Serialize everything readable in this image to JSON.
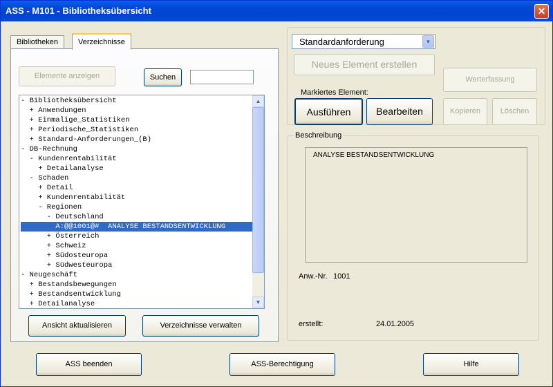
{
  "window": {
    "title": "ASS - M101 - Bibliotheksübersicht",
    "close_glyph": "✕"
  },
  "tabs": [
    {
      "label": "Bibliotheken",
      "active": false
    },
    {
      "label": "Verzeichnisse",
      "active": true
    }
  ],
  "left_panel": {
    "elemente_anzeigen": "Elemente anzeigen",
    "suchen": "Suchen",
    "search_value": "",
    "ansicht_aktualisieren": "Ansicht aktualisieren",
    "verzeichnisse_verwalten": "Verzeichnisse verwalten"
  },
  "tree": {
    "items": [
      {
        "text": "- Bibliotheksübersicht",
        "selected": false
      },
      {
        "text": "  + Anwendungen",
        "selected": false
      },
      {
        "text": "  + Einmalige_Statistiken",
        "selected": false
      },
      {
        "text": "  + Periodische_Statistiken",
        "selected": false
      },
      {
        "text": "  + Standard-Anforderungen_(B)",
        "selected": false
      },
      {
        "text": "- DB-Rechnung",
        "selected": false
      },
      {
        "text": "  - Kundenrentabilität",
        "selected": false
      },
      {
        "text": "    + Detailanalyse",
        "selected": false
      },
      {
        "text": "  - Schaden",
        "selected": false
      },
      {
        "text": "    + Detail",
        "selected": false
      },
      {
        "text": "    + Kundenrentabilität",
        "selected": false
      },
      {
        "text": "    - Regionen",
        "selected": false
      },
      {
        "text": "      - Deutschland",
        "selected": false
      },
      {
        "text": "        A:@@1001@#  ANALYSE BESTANDSENTWICKLUNG",
        "selected": true
      },
      {
        "text": "      + Österreich",
        "selected": false
      },
      {
        "text": "      + Schweiz",
        "selected": false
      },
      {
        "text": "      + Südosteuropa",
        "selected": false
      },
      {
        "text": "      + Südwesteuropa",
        "selected": false
      },
      {
        "text": "- Neugeschäft",
        "selected": false
      },
      {
        "text": "  + Bestandsbewegungen",
        "selected": false
      },
      {
        "text": "  + Bestandsentwicklung",
        "selected": false
      },
      {
        "text": "  + Detailanalyse",
        "selected": false
      }
    ],
    "scroll_up_glyph": "▲",
    "scroll_down_glyph": "▼"
  },
  "right_panel": {
    "combo_value": "Standardanforderung",
    "combo_arrow_glyph": "▼",
    "neues_element": "Neues Element erstellen",
    "werterfassung": "Werterfassung",
    "markiertes_element": "Markiertes Element:",
    "ausfuehren": "Ausführen",
    "bearbeiten": "Bearbeiten",
    "kopieren": "Kopieren",
    "loeschen": "Löschen"
  },
  "beschreibung": {
    "label": "Beschreibung",
    "text": "ANALYSE BESTANDSENTWICKLUNG",
    "anw_nr_label": "Anw.-Nr.",
    "anw_nr_value": "1001",
    "erstellt_label": "erstellt:",
    "erstellt_value": "24.01.2005"
  },
  "footer": {
    "ass_beenden": "ASS beenden",
    "ass_berechtigung": "ASS-Berechtigung",
    "hilfe": "Hilfe"
  }
}
